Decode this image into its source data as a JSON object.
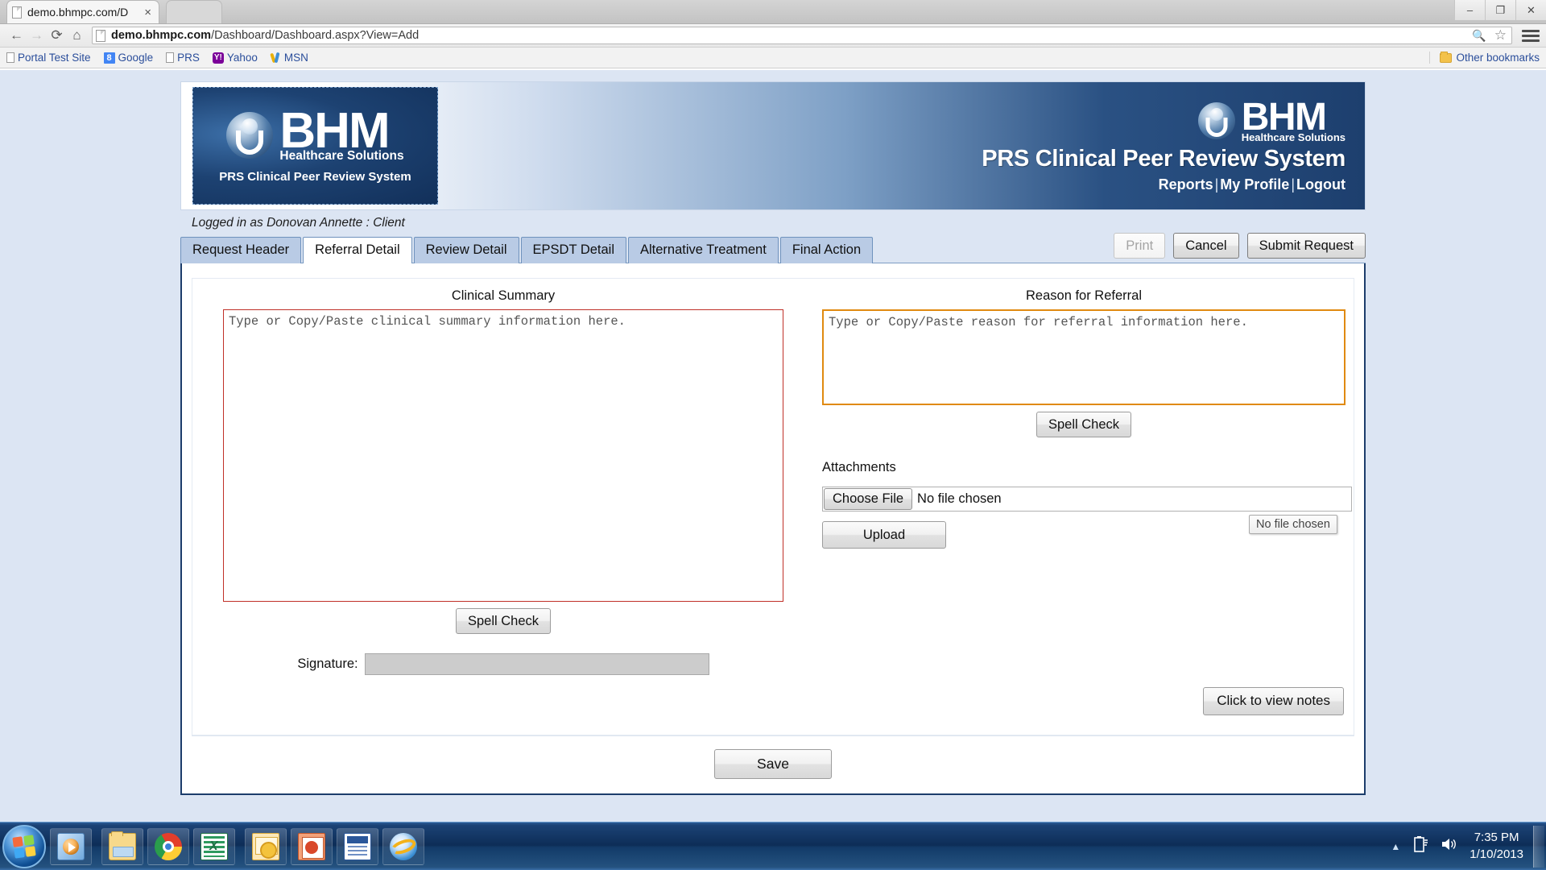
{
  "browser": {
    "tab_title": "demo.bhmpc.com/D",
    "tab_close": "×",
    "url_prefix": "demo.bhmpc.com",
    "url_suffix": "/Dashboard/Dashboard.aspx?View=Add",
    "back_icon": "←",
    "forward_icon": "→",
    "reload_icon": "⟳",
    "home_icon": "⌂",
    "zoom_icon": "🔍",
    "star_icon": "☆",
    "win_minimize": "–",
    "win_maximize": "❐",
    "win_close": "✕",
    "bookmarks": [
      {
        "label": "Portal Test Site",
        "icon": "page-icon"
      },
      {
        "label": "Google",
        "icon": "google-icon",
        "glyph": "8"
      },
      {
        "label": "PRS",
        "icon": "page-icon"
      },
      {
        "label": "Yahoo",
        "icon": "yahoo-icon",
        "glyph": "Y!"
      },
      {
        "label": "MSN",
        "icon": "msn-icon"
      }
    ],
    "other_bookmarks": "Other bookmarks"
  },
  "banner": {
    "logo_word": "BHM",
    "logo_sub": "Healthcare Solutions",
    "logo_tagline": "PRS Clinical Peer Review System",
    "title": "PRS Clinical Peer Review System",
    "links": [
      "Reports",
      "My Profile",
      "Logout"
    ],
    "separator": "|"
  },
  "session": {
    "logged_in_text": "Logged in as Donovan Annette : Client"
  },
  "tabs": [
    {
      "label": "Request Header",
      "active": false
    },
    {
      "label": "Referral Detail",
      "active": true
    },
    {
      "label": "Review Detail",
      "active": false
    },
    {
      "label": "EPSDT Detail",
      "active": false
    },
    {
      "label": "Alternative Treatment",
      "active": false
    },
    {
      "label": "Final Action",
      "active": false
    }
  ],
  "toolbar_actions": {
    "print": "Print",
    "print_disabled": true,
    "cancel": "Cancel",
    "submit": "Submit Request"
  },
  "form": {
    "clinical_summary": {
      "label": "Clinical Summary",
      "value": "Type or Copy/Paste clinical summary information here.",
      "border_color": "#c03028",
      "spell_check": "Spell Check"
    },
    "reason_for_referral": {
      "label": "Reason for Referral",
      "value": "Type or Copy/Paste reason for referral information here.",
      "border_color": "#e08a10",
      "spell_check": "Spell Check"
    },
    "signature": {
      "label": "Signature:",
      "value": "",
      "disabled": true
    },
    "attachments": {
      "label": "Attachments",
      "choose_file_button": "Choose File",
      "file_status": "No file chosen",
      "upload_button": "Upload",
      "tooltip": "No file chosen"
    },
    "notes_button": "Click to view notes",
    "save_button": "Save"
  },
  "taskbar": {
    "start": "start-orb",
    "items": [
      {
        "name": "windows-media-player-icon"
      },
      {
        "name": "file-explorer-icon"
      },
      {
        "name": "google-chrome-icon"
      },
      {
        "name": "microsoft-excel-icon"
      },
      {
        "name": "microsoft-outlook-icon"
      },
      {
        "name": "microsoft-powerpoint-icon"
      },
      {
        "name": "microsoft-word-icon"
      },
      {
        "name": "internet-explorer-icon"
      }
    ],
    "tray_arrow": "▲",
    "battery_icon": "❙",
    "volume_icon": "🔊",
    "time": "7:35 PM",
    "date": "1/10/2013"
  }
}
